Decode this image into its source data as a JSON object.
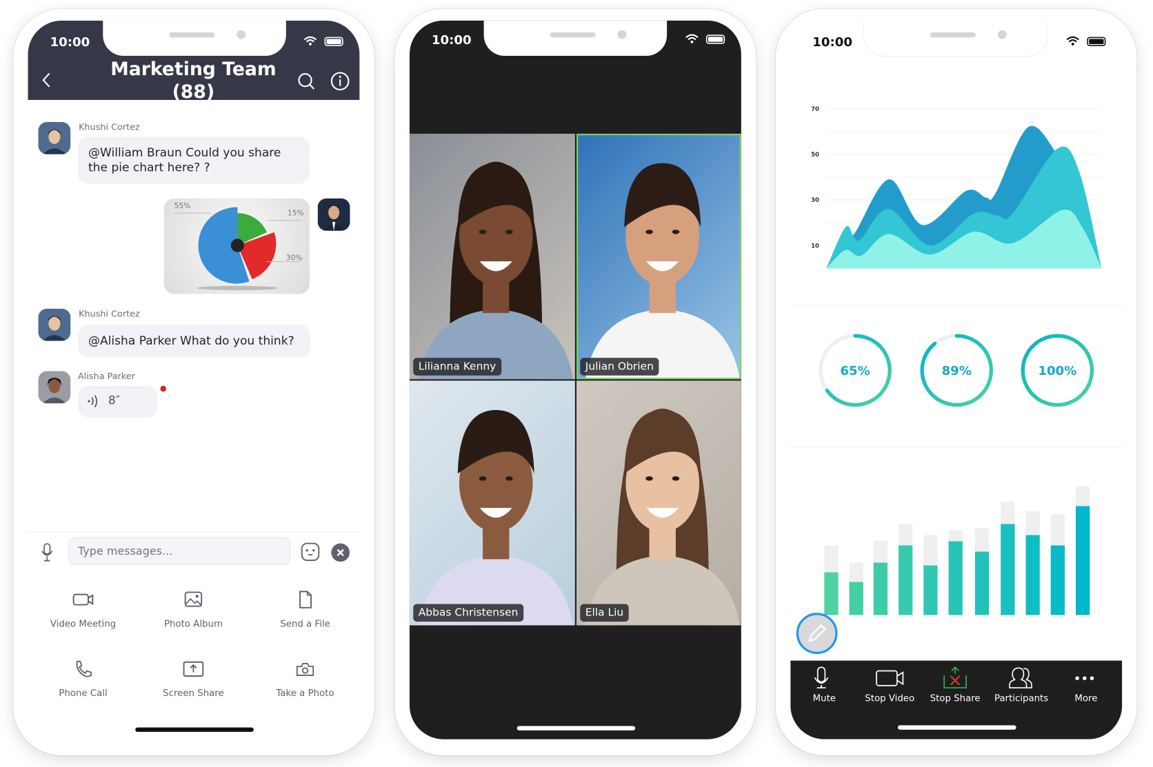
{
  "status_bar": {
    "time": "10:00"
  },
  "chat": {
    "title": "Marketing Team (88)",
    "messages": [
      {
        "sender": "Khushi Cortez",
        "text": "@William Braun Could you share the pie chart here? ?"
      },
      {
        "sender": "William Braun",
        "attachment": "pie chart image",
        "labels": [
          "55%",
          "15%",
          "30%"
        ]
      },
      {
        "sender": "Khushi Cortez",
        "text": "@Alisha Parker What do you think?"
      },
      {
        "sender": "Alisha Parker",
        "voice_duration": "8″",
        "unread": true
      }
    ],
    "input": {
      "placeholder": "Type messages...",
      "value": ""
    },
    "actions": [
      {
        "label": "Video Meeting",
        "icon": "video-camera-icon"
      },
      {
        "label": "Photo Album",
        "icon": "photo-icon"
      },
      {
        "label": "Send a File",
        "icon": "file-icon"
      },
      {
        "label": "Phone Call",
        "icon": "phone-icon"
      },
      {
        "label": "Screen Share",
        "icon": "screen-share-icon"
      },
      {
        "label": "Take a Photo",
        "icon": "camera-icon"
      }
    ]
  },
  "meeting": {
    "participants": [
      {
        "name": "Lilianna Kenny",
        "active": false
      },
      {
        "name": "Julian Obrien",
        "active": true
      },
      {
        "name": "Abbas Christensen",
        "active": false
      },
      {
        "name": "Ella Liu",
        "active": false
      }
    ],
    "active_speaker_color": "#7ed957"
  },
  "share": {
    "rings": [
      {
        "label": "65%",
        "value": 65
      },
      {
        "label": "89%",
        "value": 89
      },
      {
        "label": "100%",
        "value": 100
      }
    ],
    "toolbar": [
      {
        "label": "Mute",
        "icon": "microphone-icon"
      },
      {
        "label": "Stop Video",
        "icon": "video-camera-icon"
      },
      {
        "label": "Stop Share",
        "icon": "stop-share-icon"
      },
      {
        "label": "Participants",
        "icon": "participants-icon"
      },
      {
        "label": "More",
        "icon": "more-icon"
      }
    ]
  },
  "chart_data": [
    {
      "type": "area",
      "stacked_layers": true,
      "ytick_labels": [
        "70",
        "50",
        "30",
        "10"
      ],
      "ylim": [
        0,
        70
      ],
      "grid": true,
      "series": [
        {
          "color": "#229dcb",
          "points": [
            [
              0,
              0
            ],
            [
              6.9,
              18
            ],
            [
              10,
              15
            ],
            [
              22.7,
              39
            ],
            [
              35,
              19
            ],
            [
              50.9,
              34
            ],
            [
              58,
              31
            ],
            [
              61.5,
              33
            ],
            [
              73.4,
              62
            ],
            [
              84,
              50
            ],
            [
              92,
              35
            ],
            [
              100,
              0
            ]
          ]
        },
        {
          "color": "#33c6d4",
          "points": [
            [
              0,
              0
            ],
            [
              6.9,
              18
            ],
            [
              10,
              13.5
            ],
            [
              12.6,
              13
            ],
            [
              22.7,
              26
            ],
            [
              37.7,
              10
            ],
            [
              53.6,
              24
            ],
            [
              62.4,
              23
            ],
            [
              67.7,
              24
            ],
            [
              84,
              52.5
            ],
            [
              92,
              42
            ],
            [
              100,
              0
            ]
          ]
        },
        {
          "color": "#8ff2e6",
          "points": [
            [
              0,
              0
            ],
            [
              6.9,
              8
            ],
            [
              12.6,
              5.5
            ],
            [
              22.7,
              15
            ],
            [
              37.7,
              6
            ],
            [
              53.6,
              16
            ],
            [
              67.7,
              11
            ],
            [
              85.7,
              25.5
            ],
            [
              93,
              18
            ],
            [
              100,
              0
            ]
          ]
        }
      ]
    },
    {
      "type": "bar",
      "ylim": [
        0,
        200
      ],
      "values": [
        62,
        48,
        76,
        101,
        72,
        107,
        92,
        132,
        116,
        101,
        158
      ],
      "totals": [
        101,
        76,
        108,
        132,
        116,
        123,
        126,
        165,
        151,
        146,
        187
      ],
      "color_start": "#4fd1a0",
      "color_end": "#00b8cc"
    }
  ]
}
